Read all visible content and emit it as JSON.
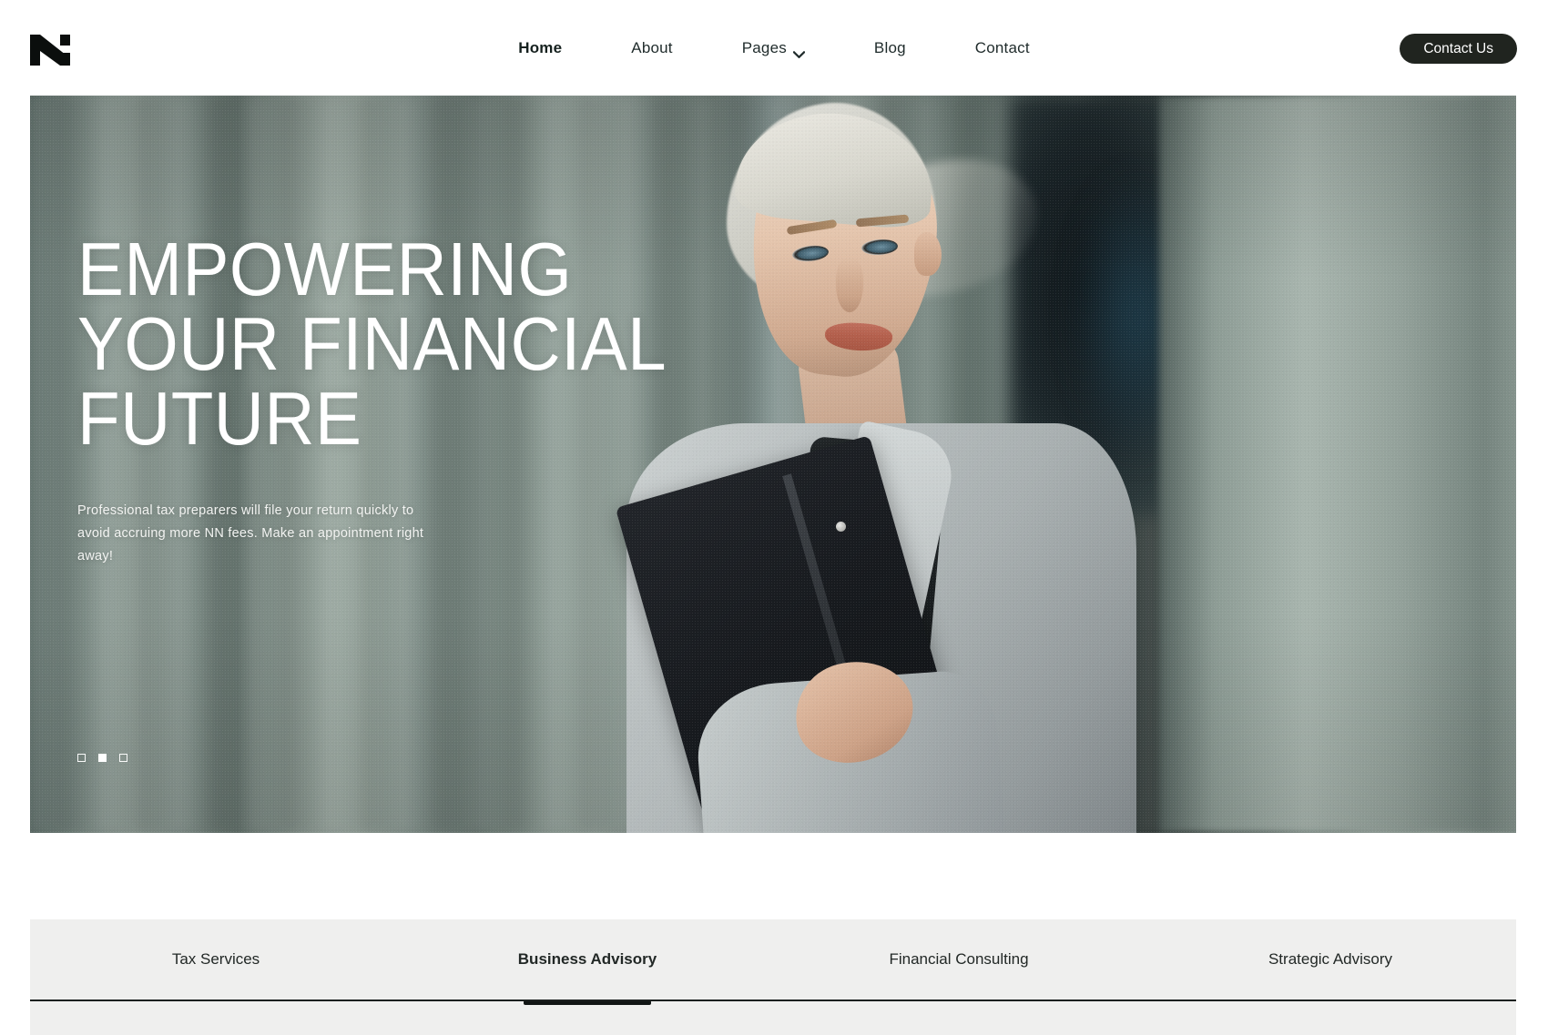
{
  "brand": {
    "logo_name": "n-monogram-logo",
    "accent_dark": "#20241f",
    "hero_overlay": "#7f8f8a",
    "tabs_bg": "#efefee"
  },
  "header": {
    "nav": [
      {
        "label": "Home",
        "active": true,
        "has_dropdown": false
      },
      {
        "label": "About",
        "active": false,
        "has_dropdown": false
      },
      {
        "label": "Pages",
        "active": false,
        "has_dropdown": true
      },
      {
        "label": "Blog",
        "active": false,
        "has_dropdown": false
      },
      {
        "label": "Contact",
        "active": false,
        "has_dropdown": false
      }
    ],
    "cta_label": "Contact Us"
  },
  "hero": {
    "headline_lines": [
      "EMPOWERING",
      "YOUR FINANCIAL",
      "FUTURE"
    ],
    "paragraph": "Professional tax preparers will file your return quickly to avoid accruing more NN fees. Make an appointment right away!",
    "slider": {
      "total": 3,
      "active_index": 1
    }
  },
  "tabs": {
    "items": [
      {
        "label": "Tax Services",
        "active": false
      },
      {
        "label": "Business Advisory",
        "active": true
      },
      {
        "label": "Financial Consulting",
        "active": false
      },
      {
        "label": "Strategic Advisory",
        "active": false
      }
    ]
  }
}
